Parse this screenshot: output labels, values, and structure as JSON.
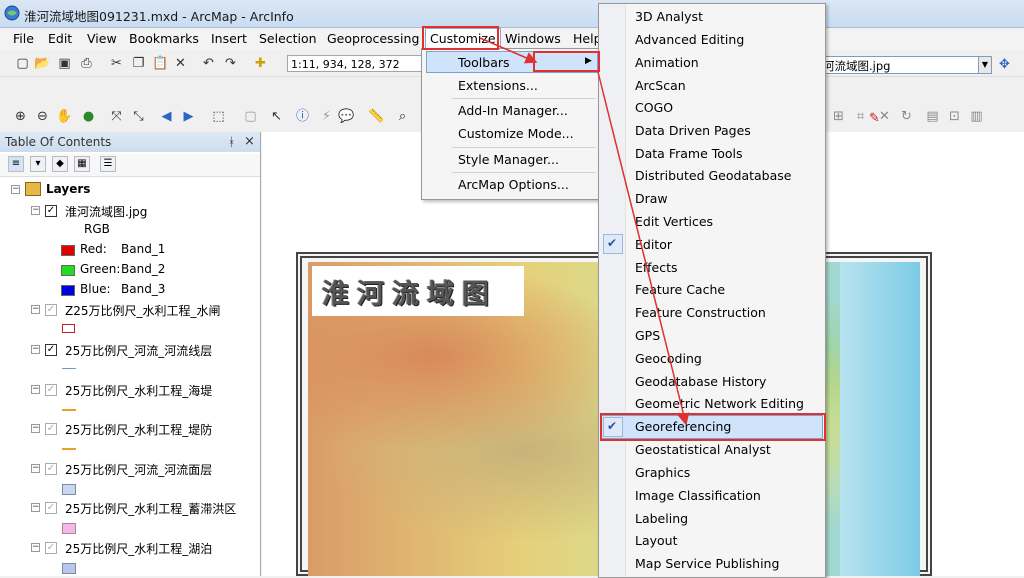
{
  "window": {
    "title": "淮河流域地图091231.mxd - ArcMap - ArcInfo",
    "icon": "arcmap-globe-icon"
  },
  "menubar": {
    "items": [
      "File",
      "Edit",
      "View",
      "Bookmarks",
      "Insert",
      "Selection",
      "Geoprocessing",
      "Customize",
      "Windows",
      "Help"
    ]
  },
  "toolbar": {
    "scale_value": "1:11, 934, 128, 372",
    "layer_value": "河流域图.jpg"
  },
  "toc": {
    "title": "Table Of Contents",
    "pin_icon": "pin-icon",
    "close_icon": "close-icon",
    "root": "Layers",
    "layer1": {
      "name": "淮河流域图.jpg",
      "rgb": "RGB",
      "bands": [
        {
          "label": "Red:",
          "band": "Band_1",
          "color": "#e00000"
        },
        {
          "label": "Green:",
          "band": "Band_2",
          "color": "#22dd22"
        },
        {
          "label": "Blue:",
          "band": "Band_3",
          "color": "#0000dd"
        }
      ]
    },
    "layers": [
      {
        "name": "Z25万比例尺_水利工程_水闸",
        "checked": false,
        "legend": "sluice-symbol"
      },
      {
        "name": "25万比例尺_河流_河流线层",
        "checked": true,
        "legend": "line-symbol"
      },
      {
        "name": "25万比例尺_水利工程_海堤",
        "checked": false,
        "legend": "line-symbol"
      },
      {
        "name": "25万比例尺_水利工程_堤防",
        "checked": false,
        "legend": "line-symbol"
      },
      {
        "name": "25万比例尺_河流_河流面层",
        "checked": false,
        "legend": "#c8d8ee"
      },
      {
        "name": "25万比例尺_水利工程_蓄滞洪区",
        "checked": false,
        "legend": "#f4b8e8"
      },
      {
        "name": "25万比例尺_水利工程_湖泊",
        "checked": false,
        "legend": "#b8c8ec"
      }
    ]
  },
  "map": {
    "title": "淮河流域图"
  },
  "customize_menu": {
    "items": [
      "Toolbars",
      "Extensions...",
      "Add-In Manager...",
      "Customize Mode...",
      "Style Manager...",
      "ArcMap Options..."
    ]
  },
  "toolbars_menu": {
    "items": [
      "3D Analyst",
      "Advanced Editing",
      "Animation",
      "ArcScan",
      "COGO",
      "Data Driven Pages",
      "Data Frame Tools",
      "Distributed Geodatabase",
      "Draw",
      "Edit Vertices",
      "Editor",
      "Effects",
      "Feature Cache",
      "Feature Construction",
      "GPS",
      "Geocoding",
      "Geodatabase History",
      "Geometric Network Editing",
      "Georeferencing",
      "Geostatistical Analyst",
      "Graphics",
      "Image Classification",
      "Labeling",
      "Layout",
      "Map Service Publishing"
    ],
    "checked": [
      "Editor",
      "Georeferencing"
    ],
    "highlighted": "Georeferencing",
    "check_icon": "checkmark-icon"
  },
  "annotation_color": "#e03030"
}
